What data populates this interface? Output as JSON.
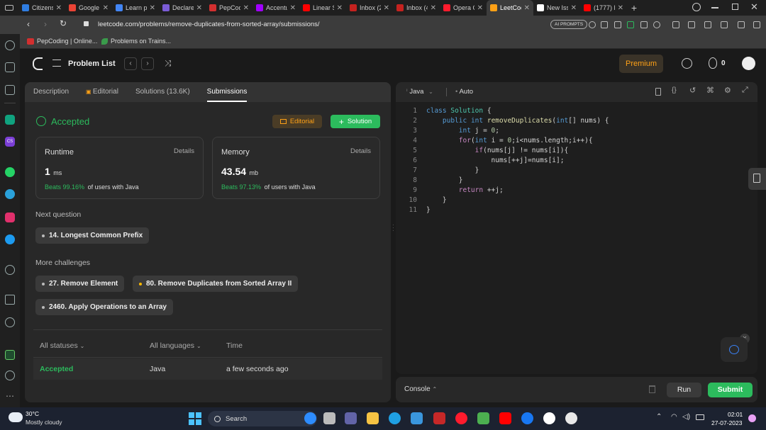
{
  "browser": {
    "tabs": [
      {
        "label": "Citizens",
        "color": "#2f7de1"
      },
      {
        "label": "Google",
        "color": "#ea4335"
      },
      {
        "label": "Learn p",
        "color": "#4285f4"
      },
      {
        "label": "Declare",
        "color": "#7b5cd6"
      },
      {
        "label": "PepCod",
        "color": "#d32f2f"
      },
      {
        "label": "Accentu",
        "color": "#a100ff"
      },
      {
        "label": "Linear S",
        "color": "#ff0000"
      },
      {
        "label": "Inbox (2",
        "color": "#c5221f"
      },
      {
        "label": "Inbox (4",
        "color": "#c5221f"
      },
      {
        "label": "Opera G",
        "color": "#ff1b2d"
      },
      {
        "label": "LeetCod",
        "color": "#ffa116"
      },
      {
        "label": "New Iss",
        "color": "#ffffff"
      },
      {
        "label": "(1777) L",
        "color": "#ff0000"
      }
    ],
    "new_tab": "+",
    "url": "leetcode.com/problems/remove-duplicates-from-sorted-array/submissions/",
    "ai_prompts": "AI PROMPTS",
    "bookmarks": [
      "PepCoding | Online...",
      "Problems on Trains..."
    ]
  },
  "header": {
    "problem_list": "Problem List",
    "premium": "Premium",
    "streak_count": "0"
  },
  "left_panel": {
    "tabs": [
      "Description",
      "Editorial",
      "Solutions (13.6K)",
      "Submissions"
    ],
    "status": "Accepted",
    "editorial_btn": "Editorial",
    "solution_btn": "Solution",
    "runtime": {
      "label": "Runtime",
      "details": "Details",
      "value": "1",
      "unit": "ms",
      "beats": "Beats 99.16%",
      "suffix": "of users with Java"
    },
    "memory": {
      "label": "Memory",
      "details": "Details",
      "value": "43.54",
      "unit": "mb",
      "beats": "Beats 97.13%",
      "suffix": "of users with Java"
    },
    "next_question_label": "Next question",
    "next_question": "14. Longest Common Prefix",
    "more_challenges_label": "More challenges",
    "challenges": [
      "27. Remove Element",
      "80. Remove Duplicates from Sorted Array II",
      "2460. Apply Operations to an Array"
    ],
    "table": {
      "headers": [
        "All statuses",
        "All languages",
        "Time"
      ],
      "row": [
        "Accepted",
        "Java",
        "a few seconds ago"
      ]
    }
  },
  "editor": {
    "language": "Java",
    "mode": "Auto",
    "line_numbers": [
      "1",
      "2",
      "3",
      "4",
      "5",
      "6",
      "7",
      "8",
      "9",
      "10",
      "11"
    ]
  },
  "console": {
    "label": "Console",
    "run": "Run",
    "submit": "Submit"
  },
  "taskbar": {
    "temperature": "30°C",
    "weather": "Mostly cloudy",
    "search": "Search",
    "time": "02:01",
    "date": "27-07-2023"
  },
  "colors": {
    "accent_green": "#2cbb5d",
    "premium": "#ffa116",
    "brand": "#ffa116"
  }
}
